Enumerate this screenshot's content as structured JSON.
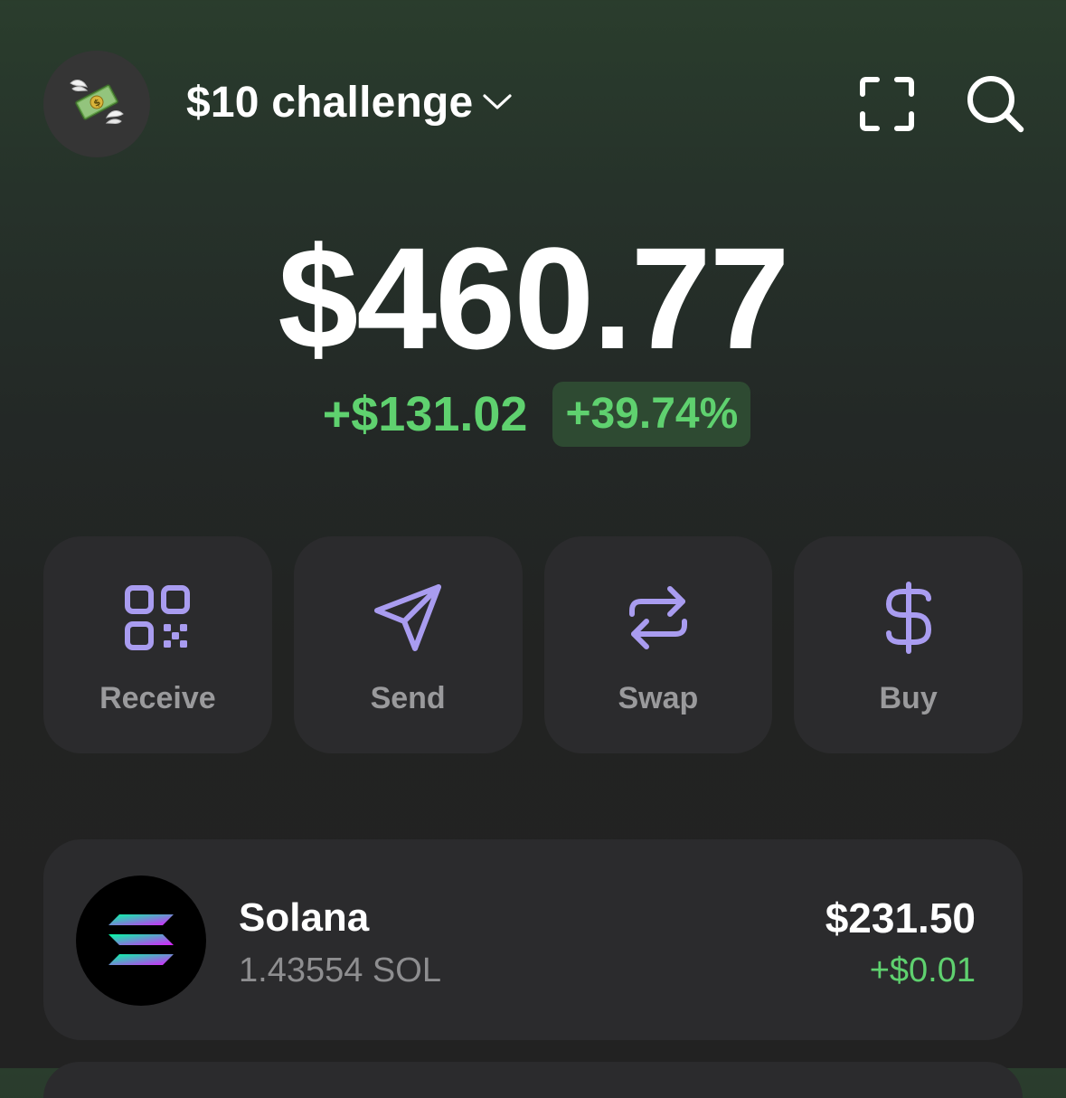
{
  "header": {
    "avatar_icon": "flying-money-emoji",
    "account_name": "$10 challenge",
    "chevron_icon": "chevron-down-icon",
    "scan_icon": "scan-icon",
    "search_icon": "search-icon"
  },
  "portfolio": {
    "balance": "$460.77",
    "change_amount": "+$131.02",
    "change_percent": "+39.74%"
  },
  "actions": [
    {
      "label": "Receive",
      "icon": "qr-code-icon"
    },
    {
      "label": "Send",
      "icon": "send-icon"
    },
    {
      "label": "Swap",
      "icon": "swap-icon"
    },
    {
      "label": "Buy",
      "icon": "dollar-icon"
    }
  ],
  "tokens": [
    {
      "name": "Solana",
      "amount": "1.43554 SOL",
      "value": "$231.50",
      "change": "+$0.01",
      "icon": "solana-logo-icon"
    }
  ],
  "colors": {
    "accent_purple": "#a99cf0",
    "positive_green": "#5fd16f",
    "card_bg": "#2b2b2d"
  }
}
